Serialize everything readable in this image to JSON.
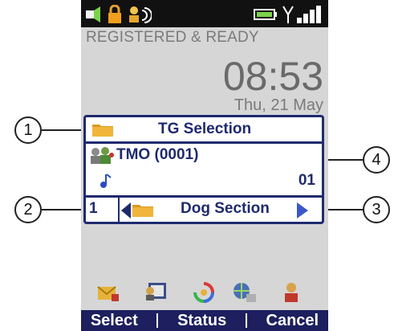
{
  "status_bar": {
    "icons": [
      "signal-strength-icon",
      "lock-icon",
      "user-audio-icon",
      "battery-icon",
      "antenna-icon",
      "signal-bars-icon"
    ]
  },
  "status_text": "REGISTERED & READY",
  "clock": "08:53",
  "date": "Thu, 21 May",
  "panel": {
    "header": "TG Selection",
    "group_name": "TMO (0001)",
    "group_number": "01",
    "index": "1",
    "folder": "Dog Section"
  },
  "callouts": [
    "1",
    "2",
    "3",
    "4"
  ],
  "shortcut_icons": [
    "message-icon",
    "contacts-icon",
    "refresh-icon",
    "network-icon",
    "person-icon"
  ],
  "softkeys": {
    "left": "Select",
    "middle": "Status",
    "right": "Cancel"
  },
  "colors": {
    "panel_border": "#1f2a6e",
    "softkey_bar": "#1d1f5e",
    "screen_bg": "#d6d6d6"
  }
}
